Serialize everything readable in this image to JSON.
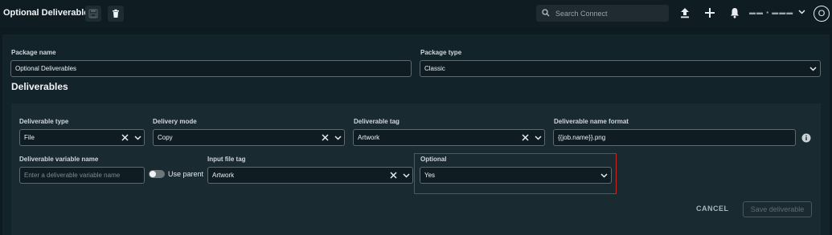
{
  "header": {
    "title": "Optional Deliverables",
    "search_placeholder": "Search Connect",
    "user_name": "▬▬ ▪ ▬▬▬ ▬"
  },
  "avatar": {
    "initial": "O"
  },
  "package": {
    "name_label": "Package name",
    "name_value": "Optional Deliverables",
    "type_label": "Package type",
    "type_value": "Classic"
  },
  "section_title": "Deliverables",
  "deliverable": {
    "type_label": "Deliverable type",
    "type_value": "File",
    "delivery_mode_label": "Delivery mode",
    "delivery_mode_value": "Copy",
    "tag_label": "Deliverable tag",
    "tag_value": "Artwork",
    "name_format_label": "Deliverable name format",
    "name_format_value": "{{job.name}}.png",
    "variable_name_label": "Deliverable variable name",
    "variable_name_placeholder": "Enter a deliverable variable name",
    "use_parent_label": "Use parent",
    "input_file_tag_label": "Input file tag",
    "input_file_tag_value": "Artwork",
    "optional_label": "Optional",
    "optional_value": "Yes"
  },
  "actions": {
    "cancel_label": "CANCEL",
    "save_label": "Save deliverable"
  },
  "colors": {
    "background": "#0d1a20",
    "panel": "#13232a",
    "inner_panel": "#1a2a31",
    "highlight": "#c62828"
  }
}
